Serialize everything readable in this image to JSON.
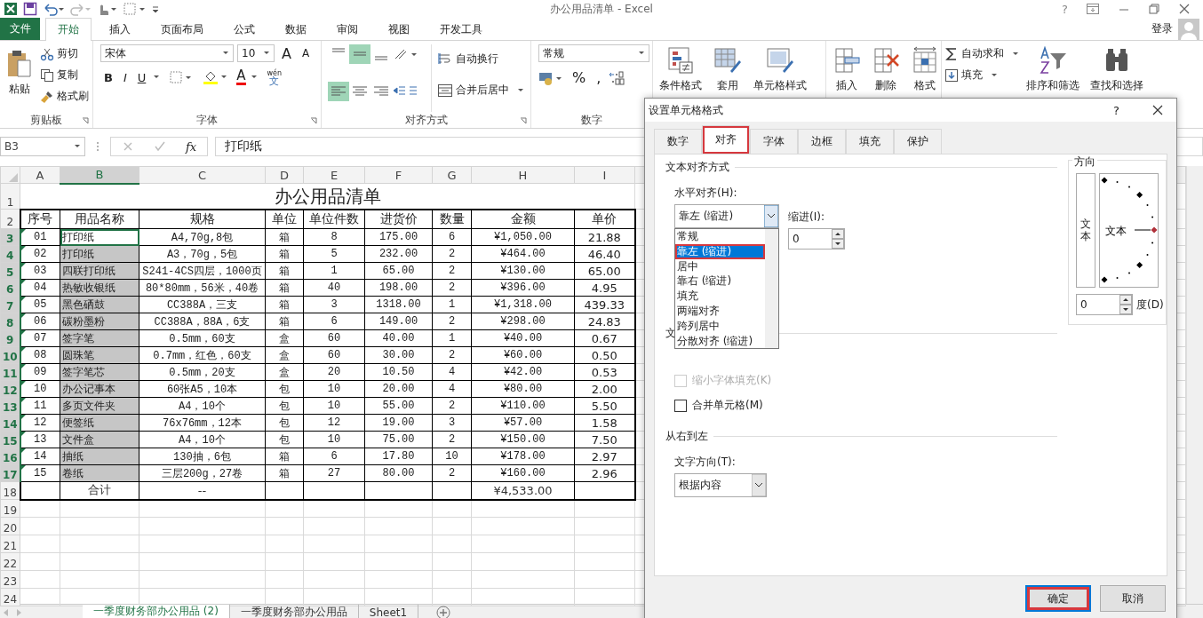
{
  "window": {
    "title": "办公用品清单 - Excel",
    "help": "?"
  },
  "file_tab": "文件",
  "tabs": [
    {
      "label": "开始",
      "selected": true
    },
    {
      "label": "插入",
      "selected": false
    },
    {
      "label": "页面布局",
      "selected": false
    },
    {
      "label": "公式",
      "selected": false
    },
    {
      "label": "数据",
      "selected": false
    },
    {
      "label": "审阅",
      "selected": false
    },
    {
      "label": "视图",
      "selected": false
    },
    {
      "label": "开发工具",
      "selected": false
    }
  ],
  "account": "登录",
  "ribbon": {
    "clipboard": {
      "label": "剪贴板",
      "paste": "粘贴",
      "cut": "剪切",
      "copy": "复制",
      "painter": "格式刷"
    },
    "font": {
      "label": "字体",
      "name": "宋体",
      "size": "10",
      "grow": "A",
      "shrink": "A",
      "font_color": "A",
      "phonetic_top": "wén",
      "phonetic_bottom": "文",
      "styles": [
        {
          "kind": "bold",
          "label": "B"
        },
        {
          "kind": "italic",
          "label": "I"
        },
        {
          "kind": "underline",
          "label": "U"
        }
      ]
    },
    "alignment": {
      "label": "对齐方式",
      "wrap": "自动换行",
      "merge": "合并后居中",
      "vertical": [
        {
          "kind": "top",
          "selected": false
        },
        {
          "kind": "middle",
          "selected": true
        },
        {
          "kind": "bottom",
          "selected": false
        }
      ],
      "horizontal": [
        {
          "kind": "left",
          "selected": true
        },
        {
          "kind": "center",
          "selected": false
        },
        {
          "kind": "right",
          "selected": false
        }
      ]
    },
    "number": {
      "label": "数字",
      "format": "常规",
      "percent": "%",
      "comma": ","
    },
    "styles": [
      {
        "kind": "conditional",
        "label": "条件格式"
      },
      {
        "kind": "table",
        "label": "套用"
      },
      {
        "kind": "cellstyle",
        "label": "单元格样式"
      }
    ],
    "cells": [
      {
        "kind": "insert",
        "label": "插入"
      },
      {
        "kind": "delete",
        "label": "删除"
      },
      {
        "kind": "format",
        "label": "格式"
      }
    ],
    "editing": {
      "autosum": "自动求和",
      "fill": "填充",
      "sort": "排序和筛选",
      "find": "查找和选择"
    }
  },
  "formula_bar": {
    "name_box": "B3",
    "function_label": "fx",
    "value": "打印纸"
  },
  "sheet": {
    "column_headers": [
      {
        "label": "A",
        "selected": false
      },
      {
        "label": "B",
        "selected": true
      },
      {
        "label": "C",
        "selected": false
      },
      {
        "label": "D",
        "selected": false
      },
      {
        "label": "E",
        "selected": false
      },
      {
        "label": "F",
        "selected": false
      },
      {
        "label": "G",
        "selected": false
      },
      {
        "label": "H",
        "selected": false
      },
      {
        "label": "I",
        "selected": false
      }
    ],
    "row_headers": [
      {
        "label": "1",
        "selected": false
      },
      {
        "label": "2",
        "selected": false
      },
      {
        "label": "3",
        "selected": true
      },
      {
        "label": "4",
        "selected": true
      },
      {
        "label": "5",
        "selected": true
      },
      {
        "label": "6",
        "selected": true
      },
      {
        "label": "7",
        "selected": true
      },
      {
        "label": "8",
        "selected": true
      },
      {
        "label": "9",
        "selected": true
      },
      {
        "label": "10",
        "selected": true
      },
      {
        "label": "11",
        "selected": true
      },
      {
        "label": "12",
        "selected": true
      },
      {
        "label": "13",
        "selected": true
      },
      {
        "label": "14",
        "selected": true
      },
      {
        "label": "15",
        "selected": true
      },
      {
        "label": "16",
        "selected": true
      },
      {
        "label": "17",
        "selected": true
      },
      {
        "label": "18",
        "selected": false
      },
      {
        "label": "19",
        "selected": false
      },
      {
        "label": "20",
        "selected": false
      },
      {
        "label": "21",
        "selected": false
      },
      {
        "label": "22",
        "selected": false
      },
      {
        "label": "23",
        "selected": false
      },
      {
        "label": "24",
        "selected": false
      }
    ],
    "title": "办公用品清单",
    "header": [
      "序号",
      "用品名称",
      "规格",
      "单位",
      "单位件数",
      "进货价",
      "数量",
      "金额",
      "单价"
    ],
    "rows": [
      {
        "selected": true,
        "active": true,
        "flagged": true,
        "cells": [
          "01",
          "打印纸",
          "A4,70g,8包",
          "箱",
          "8",
          "175.00",
          "6",
          "¥1,050.00",
          "21.88"
        ]
      },
      {
        "selected": true,
        "active": false,
        "flagged": true,
        "cells": [
          "02",
          "打印纸",
          "A3，70g，5包",
          "箱",
          "5",
          "232.00",
          "2",
          "¥464.00",
          "46.40"
        ]
      },
      {
        "selected": true,
        "active": false,
        "flagged": true,
        "cells": [
          "03",
          "四联打印纸",
          "S241-4CS四层，1000页",
          "箱",
          "1",
          "65.00",
          "2",
          "¥130.00",
          "65.00"
        ]
      },
      {
        "selected": true,
        "active": false,
        "flagged": true,
        "cells": [
          "04",
          "热敏收银纸",
          "80*80mm，56米，40卷",
          "箱",
          "40",
          "198.00",
          "2",
          "¥396.00",
          "4.95"
        ]
      },
      {
        "selected": true,
        "active": false,
        "flagged": true,
        "cells": [
          "05",
          "黑色硒鼓",
          "CC388A，三支",
          "箱",
          "3",
          "1318.00",
          "1",
          "¥1,318.00",
          "439.33"
        ]
      },
      {
        "selected": true,
        "active": false,
        "flagged": true,
        "cells": [
          "06",
          "碳粉墨粉",
          "CC388A，88A，6支",
          "箱",
          "6",
          "149.00",
          "2",
          "¥298.00",
          "24.83"
        ]
      },
      {
        "selected": true,
        "active": false,
        "flagged": true,
        "cells": [
          "07",
          "签字笔",
          "0.5mm，60支",
          "盒",
          "60",
          "40.00",
          "1",
          "¥40.00",
          "0.67"
        ]
      },
      {
        "selected": true,
        "active": false,
        "flagged": true,
        "cells": [
          "08",
          "圆珠笔",
          "0.7mm，红色，60支",
          "盒",
          "60",
          "30.00",
          "2",
          "¥60.00",
          "0.50"
        ]
      },
      {
        "selected": true,
        "active": false,
        "flagged": true,
        "cells": [
          "09",
          "签字笔芯",
          "0.5mm，20支",
          "盒",
          "20",
          "10.50",
          "4",
          "¥42.00",
          "0.53"
        ]
      },
      {
        "selected": true,
        "active": false,
        "flagged": true,
        "cells": [
          "10",
          "办公记事本",
          "60张A5，10本",
          "包",
          "10",
          "20.00",
          "4",
          "¥80.00",
          "2.00"
        ]
      },
      {
        "selected": true,
        "active": false,
        "flagged": true,
        "cells": [
          "11",
          "多页文件夹",
          "A4，10个",
          "包",
          "10",
          "55.00",
          "2",
          "¥110.00",
          "5.50"
        ]
      },
      {
        "selected": true,
        "active": false,
        "flagged": true,
        "cells": [
          "12",
          "便签纸",
          "76x76mm，12本",
          "包",
          "12",
          "19.00",
          "3",
          "¥57.00",
          "1.58"
        ]
      },
      {
        "selected": true,
        "active": false,
        "flagged": true,
        "cells": [
          "13",
          "文件盒",
          "A4，10个",
          "包",
          "10",
          "75.00",
          "2",
          "¥150.00",
          "7.50"
        ]
      },
      {
        "selected": true,
        "active": false,
        "flagged": true,
        "cells": [
          "14",
          "抽纸",
          "130抽，6包",
          "箱",
          "6",
          "17.80",
          "10",
          "¥178.00",
          "2.97"
        ]
      },
      {
        "selected": true,
        "active": false,
        "flagged": true,
        "cells": [
          "15",
          "卷纸",
          "三层200g，27卷",
          "箱",
          "27",
          "80.00",
          "2",
          "¥160.00",
          "2.96"
        ]
      }
    ],
    "total": {
      "label": "合计",
      "spec": "--",
      "amount": "¥4,533.00"
    }
  },
  "sheet_tabs": [
    {
      "label": "一季度财务部办公用品 (2)",
      "selected": true
    },
    {
      "label": "一季度财务部办公用品",
      "selected": false
    },
    {
      "label": "Sheet1",
      "selected": false
    }
  ],
  "dialog": {
    "title": "设置单元格格式",
    "help": "?",
    "tabs": [
      {
        "label": "数字",
        "selected": false,
        "highlighted": false
      },
      {
        "label": "对齐",
        "selected": true,
        "highlighted": true
      },
      {
        "label": "字体",
        "selected": false,
        "highlighted": false
      },
      {
        "label": "边框",
        "selected": false,
        "highlighted": false
      },
      {
        "label": "填充",
        "selected": false,
        "highlighted": false
      },
      {
        "label": "保护",
        "selected": false,
        "highlighted": false
      }
    ],
    "text_alignment": "文本对齐方式",
    "horizontal_label": "水平对齐(H):",
    "horizontal_value": "靠左 (缩进)",
    "options": [
      {
        "label": "常规",
        "selected": false,
        "highlighted": false
      },
      {
        "label": "靠左 (缩进)",
        "selected": true,
        "highlighted": true
      },
      {
        "label": "居中",
        "selected": false,
        "highlighted": false
      },
      {
        "label": "靠右 (缩进)",
        "selected": false,
        "highlighted": false
      },
      {
        "label": "填充",
        "selected": false,
        "highlighted": false
      },
      {
        "label": "两端对齐",
        "selected": false,
        "highlighted": false
      },
      {
        "label": "跨列居中",
        "selected": false,
        "highlighted": false
      },
      {
        "label": "分散对齐 (缩进)",
        "selected": false,
        "highlighted": false
      }
    ],
    "indent_label": "缩进(I):",
    "indent_value": "0",
    "text_control": "文",
    "checkboxes": [
      {
        "label": "缩小字体填充(K)",
        "checked": false,
        "disabled": true
      },
      {
        "label": "合并单元格(M)",
        "checked": false,
        "disabled": false
      }
    ],
    "rtl": "从右到左",
    "direction_label": "文字方向(T):",
    "direction_value": "根据内容",
    "orientation": "方向",
    "vertical_text": "文本",
    "dial_text": "文本",
    "degrees_value": "0",
    "degrees_label": "度(D)",
    "buttons": [
      {
        "label": "确定",
        "default": true,
        "highlighted": true
      },
      {
        "label": "取消",
        "default": false,
        "highlighted": false
      }
    ]
  }
}
